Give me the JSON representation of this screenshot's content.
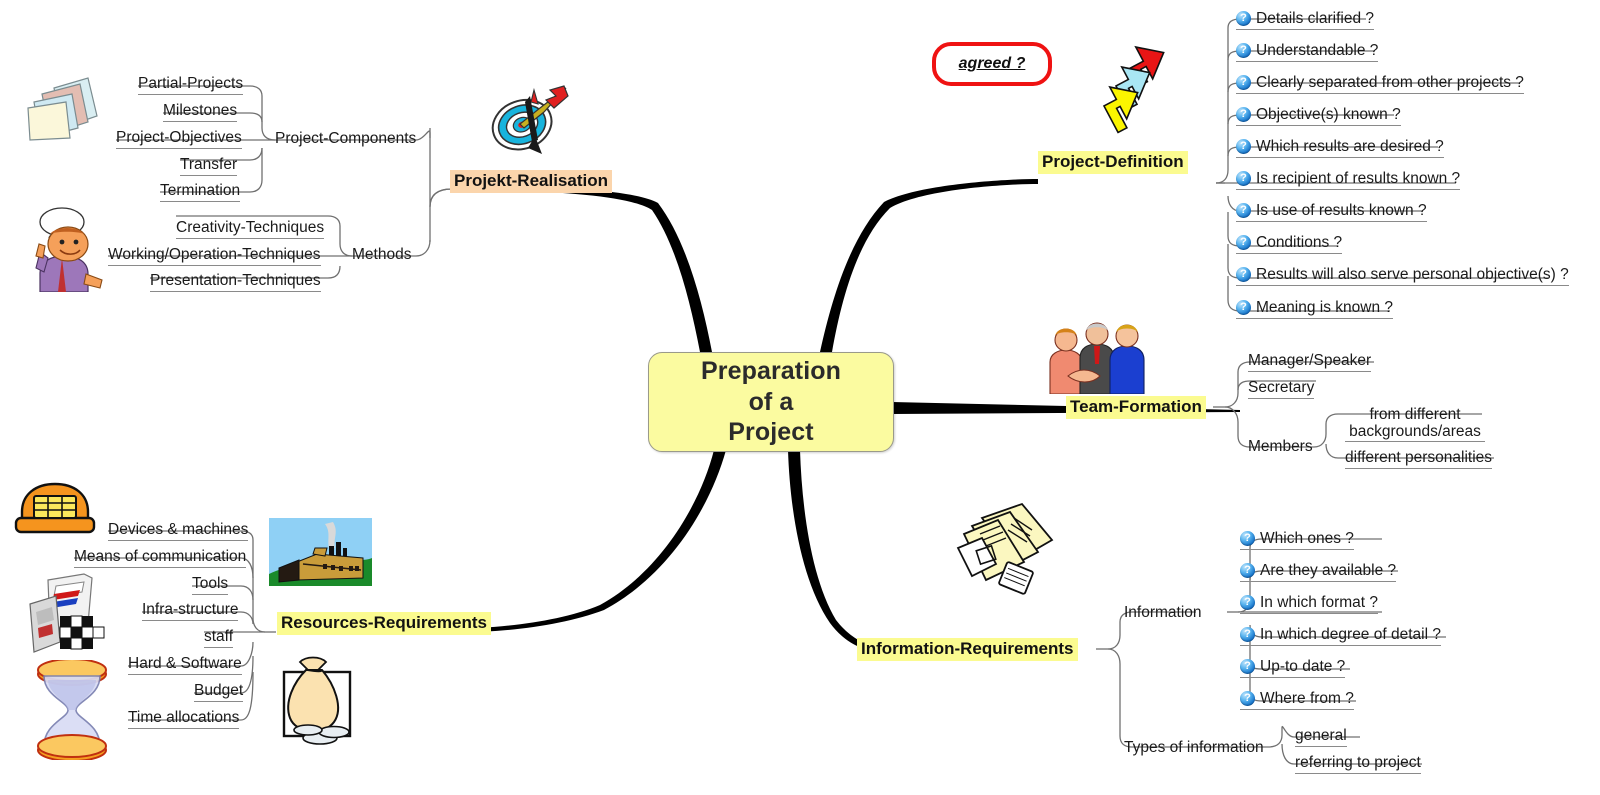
{
  "central": {
    "title": "Preparation\nof a\nProject"
  },
  "callout": {
    "text": "agreed ?"
  },
  "branches": {
    "projekt_realisation": {
      "label": "Projekt-Realisation",
      "groups": [
        {
          "label": "Project-Components",
          "items": [
            "Partial-Projects",
            "Milestones",
            "Project-Objectives",
            "Transfer",
            "Termination"
          ]
        },
        {
          "label": "Methods",
          "items": [
            "Creativity-Techniques",
            "Working/Operation-Techniques",
            "Presentation-Techniques"
          ]
        }
      ]
    },
    "project_definition": {
      "label": "Project-Definition",
      "items": [
        "Details clarified ?",
        "Understandable ?",
        "Clearly separated from other projects ?",
        "Objective(s) known ?",
        "Which results are desired ?",
        "Is recipient of results known ?",
        "Is use of results known ?",
        "Conditions ?",
        "Results will also serve personal objective(s) ?",
        "Meaning is known ?"
      ]
    },
    "team_formation": {
      "label": "Team-Formation",
      "items": [
        "Manager/Speaker",
        "Secretary",
        "Members"
      ],
      "members_sub": [
        "from different backgrounds/areas",
        "different personalities"
      ]
    },
    "information_requirements": {
      "label": "Information-Requirements",
      "groups": [
        {
          "label": "Information",
          "items": [
            "Which ones ?",
            "Are they available ?",
            "In which format ?",
            "In which degree of detail ?",
            "Up-to date ?",
            "Where from ?"
          ]
        },
        {
          "label": "Types of information",
          "items": [
            "general",
            "referring to project"
          ]
        }
      ]
    },
    "resources_requirements": {
      "label": "Resources-Requirements",
      "items": [
        "Devices & machines",
        "Means of communication",
        "Tools",
        "Infra-structure",
        "staff",
        "Hard & Software",
        "Budget",
        "Time allocations"
      ]
    }
  },
  "icons": {
    "folders": "folder-stack-icon",
    "thinker": "thinking-person-icon",
    "dartboard": "dartboard-arrow-icon",
    "arrows": "three-arrows-icon",
    "handshake": "three-people-handshake-icon",
    "newspapers": "newspapers-icon",
    "telephone": "telephone-icon",
    "printer": "printer-icon",
    "hourglass": "hourglass-icon",
    "factory": "factory-icon",
    "moneybag": "money-bag-icon",
    "question": "question-mark-icon"
  },
  "colors": {
    "central_fill": "#FBFBA0",
    "highlight_yellow": "#FBFB90",
    "highlight_orange": "#FBD5AC",
    "callout_red": "#EF1212",
    "branch_black": "#000000",
    "connector_gray": "#707070"
  }
}
